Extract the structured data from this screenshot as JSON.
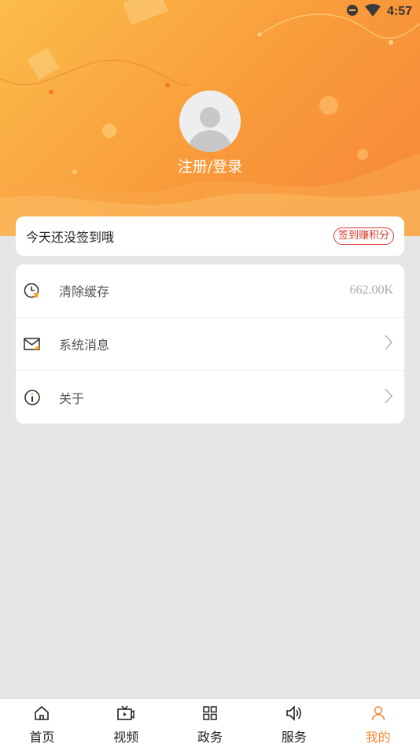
{
  "status_bar": {
    "time": "4:57"
  },
  "profile": {
    "login_label": "注册/登录"
  },
  "checkin": {
    "message": "今天还没签到哦",
    "badge": "签到赚积分"
  },
  "menu": {
    "items": [
      {
        "label": "清除缓存",
        "value": "662.00K",
        "icon": "clock-clean-icon"
      },
      {
        "label": "系统消息",
        "icon": "mail-icon"
      },
      {
        "label": "关于",
        "icon": "info-icon"
      }
    ]
  },
  "bottom_nav": {
    "items": [
      {
        "label": "首页",
        "icon": "home-icon"
      },
      {
        "label": "视频",
        "icon": "tv-icon"
      },
      {
        "label": "政务",
        "icon": "grid-icon"
      },
      {
        "label": "服务",
        "icon": "speaker-icon"
      },
      {
        "label": "我的",
        "icon": "person-icon"
      }
    ],
    "active_index": 4
  },
  "colors": {
    "accent": "#f58a36",
    "header_start": "#fbbd4a",
    "header_end": "#f6873a",
    "badge": "#d83a2e"
  }
}
